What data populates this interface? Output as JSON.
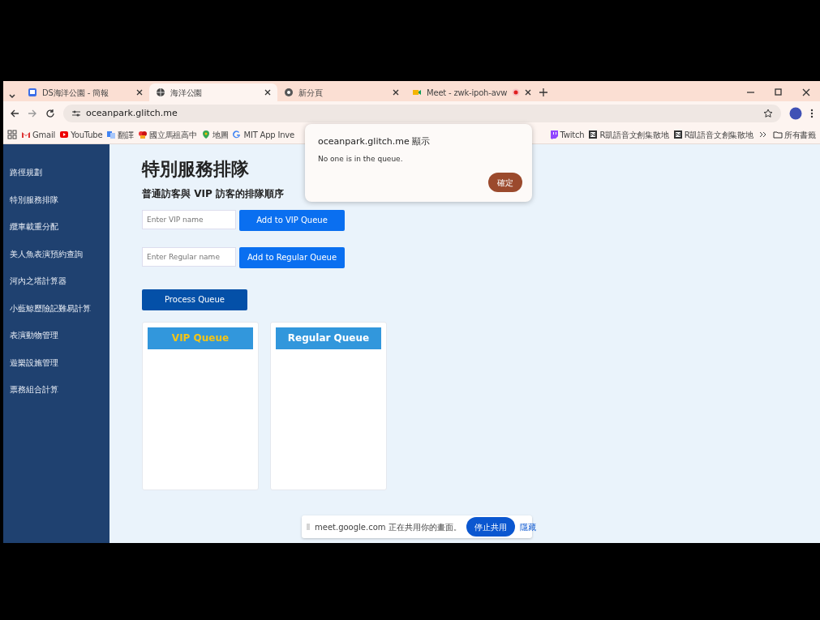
{
  "tabs": [
    {
      "label": "DS海洋公園 - 簡報",
      "selected": false
    },
    {
      "label": "海洋公園",
      "selected": true
    },
    {
      "label": "新分頁",
      "selected": false
    },
    {
      "label": "Meet - zwk-ipoh-avw",
      "selected": false,
      "recording": true
    }
  ],
  "address": "oceanpark.glitch.me",
  "bookmarks": [
    {
      "label": "Gmail"
    },
    {
      "label": "YouTube"
    },
    {
      "label": "翻譯"
    },
    {
      "label": "國立馬祖高中"
    },
    {
      "label": "地圖"
    },
    {
      "label": "MIT App Inve"
    }
  ],
  "bookmarks_right": [
    {
      "label": "Twitch"
    },
    {
      "label": "R凱語音文創集散地"
    },
    {
      "label": "R凱語音文創集散地"
    }
  ],
  "all_bookmarks": "所有書籤",
  "sidebar": {
    "items": [
      {
        "label": "路徑規劃"
      },
      {
        "label": "特別服務排隊"
      },
      {
        "label": "纜車載重分配"
      },
      {
        "label": "美人魚表演預約查詢"
      },
      {
        "label": "河內之塔計算器"
      },
      {
        "label": "小藍鯨歷險記難易計算"
      },
      {
        "label": "表演動物管理"
      },
      {
        "label": "遊樂設施管理"
      },
      {
        "label": "票務組合計算"
      }
    ]
  },
  "page": {
    "title": "特別服務排隊",
    "subtitle": "普通訪客與 VIP 訪客的排隊順序",
    "forms": [
      {
        "placeholder": "Enter VIP name",
        "button": "Add to VIP Queue"
      },
      {
        "placeholder": "Enter Regular name",
        "button": "Add to Regular Queue"
      }
    ],
    "process_button": "Process Queue",
    "queues": [
      {
        "title": "VIP Queue",
        "kind": "vip"
      },
      {
        "title": "Regular Queue",
        "kind": "regular"
      }
    ]
  },
  "dialog": {
    "title": "oceanpark.glitch.me 顯示",
    "message": "No one is in the queue.",
    "button": "確定"
  },
  "share_bar": {
    "message": "meet.google.com 正在共用你的畫面。",
    "stop_button": "停止共用",
    "hide_link": "隱藏"
  }
}
